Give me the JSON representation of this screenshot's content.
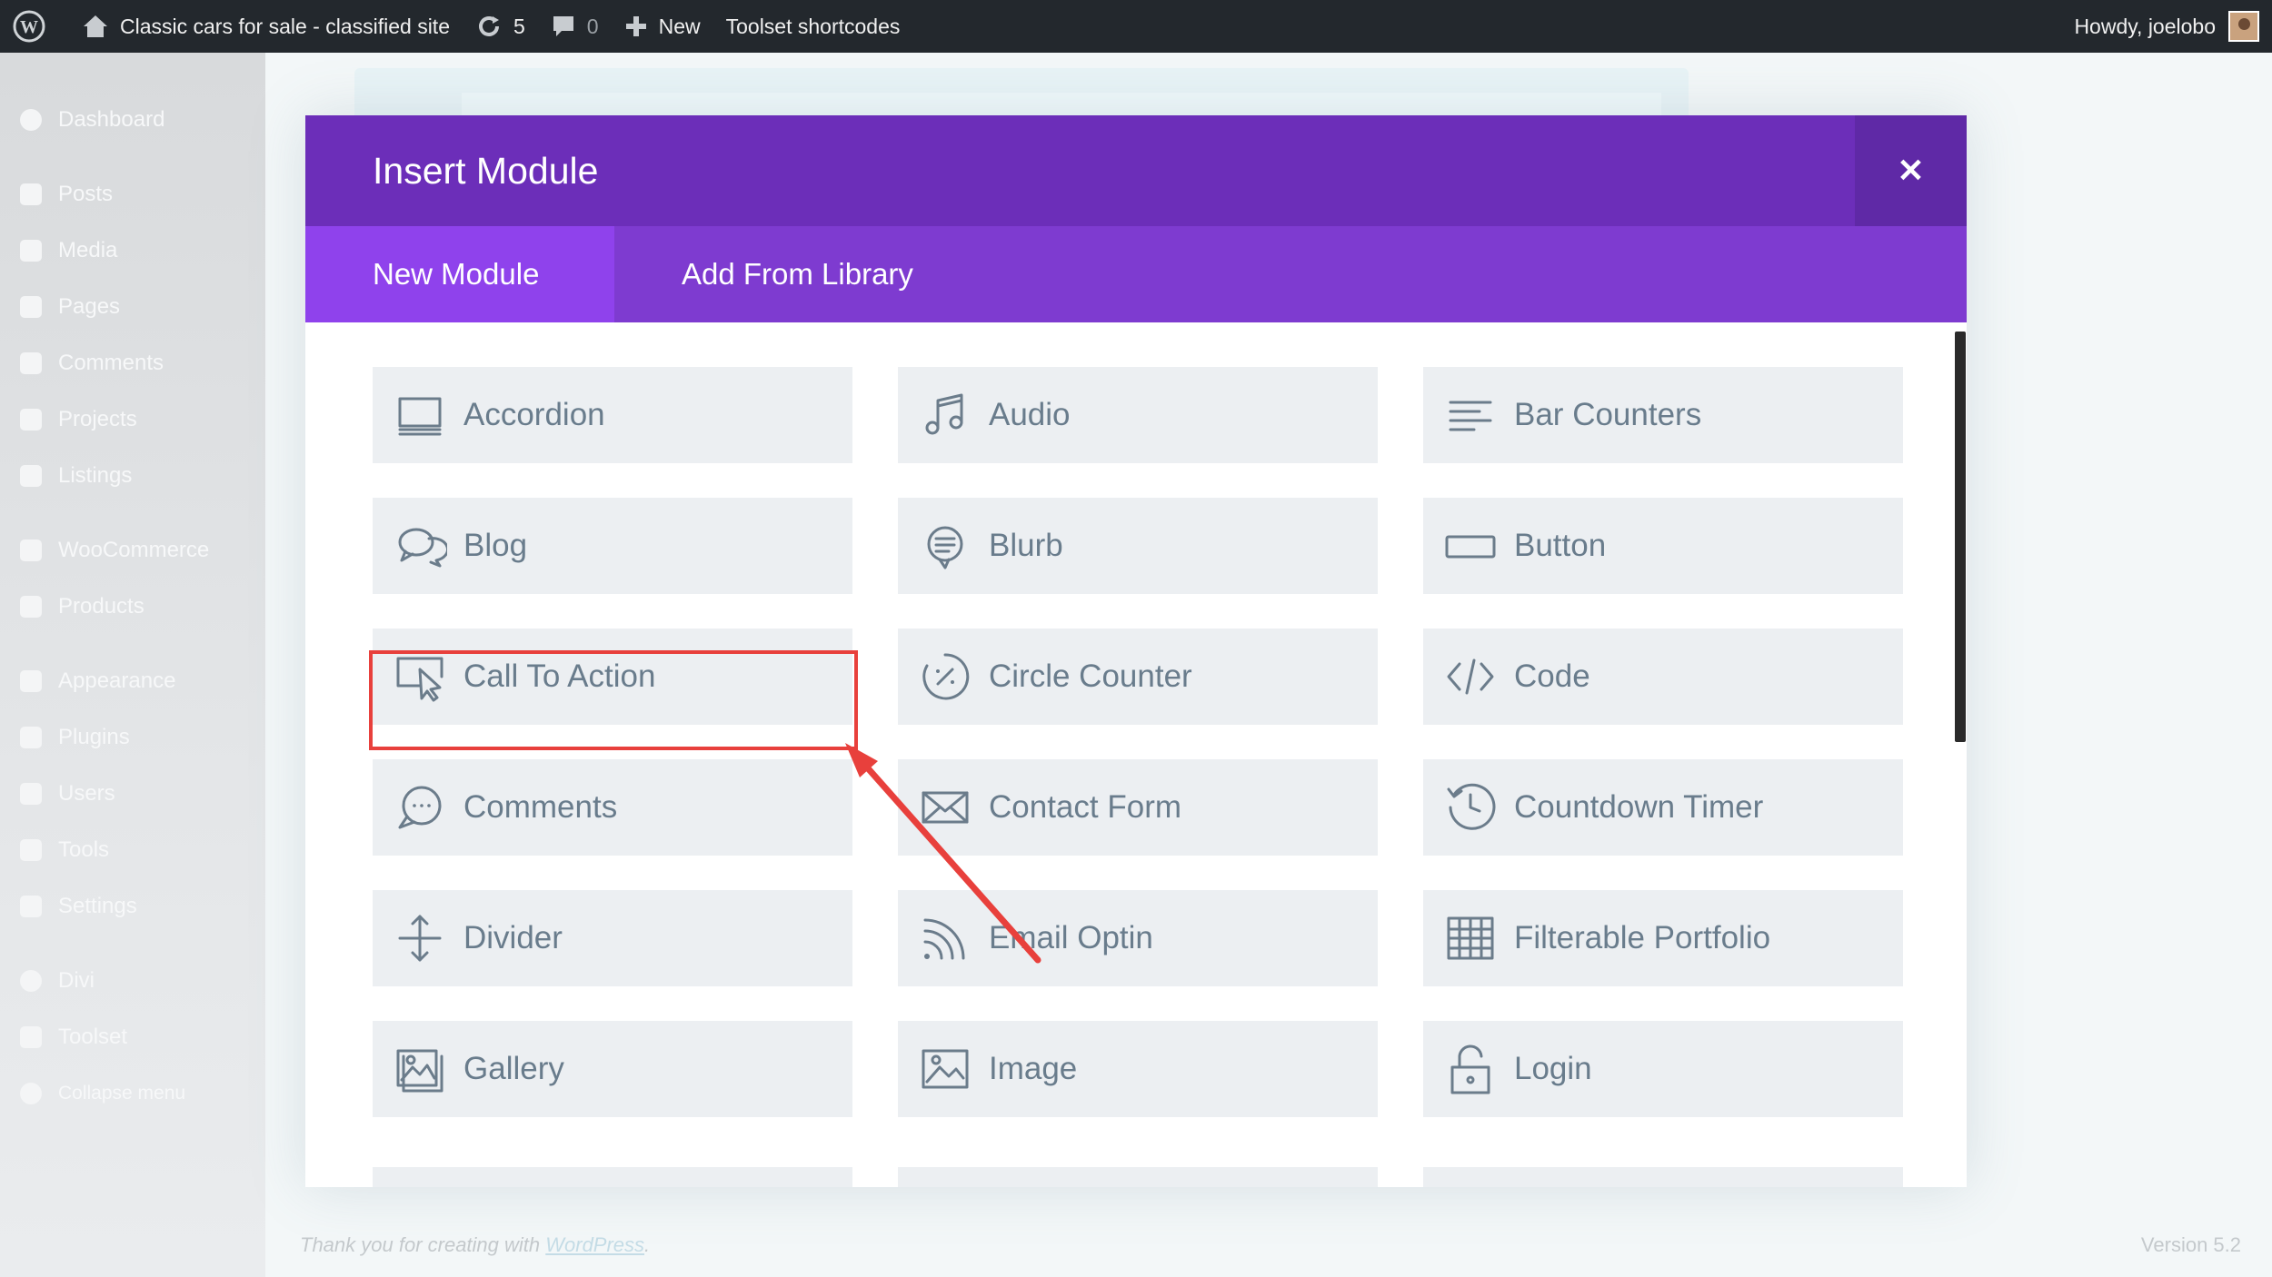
{
  "adminbar": {
    "site_name": "Classic cars for sale - classified site",
    "updates_count": "5",
    "comments_count": "0",
    "new_label": "New",
    "toolset_label": "Toolset shortcodes",
    "howdy": "Howdy, joelobo"
  },
  "sidebar": {
    "items": [
      {
        "label": "Dashboard",
        "icon": "dashboard-icon"
      },
      {
        "label": "Posts",
        "icon": "pin-icon"
      },
      {
        "label": "Media",
        "icon": "media-icon"
      },
      {
        "label": "Pages",
        "icon": "pages-icon"
      },
      {
        "label": "Comments",
        "icon": "comment-icon"
      },
      {
        "label": "Projects",
        "icon": "pin-icon"
      },
      {
        "label": "Listings",
        "icon": "pin-icon"
      },
      {
        "label": "WooCommerce",
        "icon": "woo-icon"
      },
      {
        "label": "Products",
        "icon": "box-icon"
      },
      {
        "label": "Appearance",
        "icon": "brush-icon"
      },
      {
        "label": "Plugins",
        "icon": "plug-icon"
      },
      {
        "label": "Users",
        "icon": "user-icon"
      },
      {
        "label": "Tools",
        "icon": "wrench-icon"
      },
      {
        "label": "Settings",
        "icon": "settings-icon"
      },
      {
        "label": "Divi",
        "icon": "divi-icon"
      },
      {
        "label": "Toolset",
        "icon": "toolset-icon"
      },
      {
        "label": "Collapse menu",
        "icon": "collapse-icon"
      }
    ]
  },
  "modal": {
    "title": "Insert Module",
    "close_symbol": "✕",
    "tabs": {
      "new_module": "New Module",
      "add_from_library": "Add From Library"
    },
    "modules": [
      {
        "label": "Accordion",
        "icon": "accordion-icon"
      },
      {
        "label": "Audio",
        "icon": "music-note-icon"
      },
      {
        "label": "Bar Counters",
        "icon": "bar-lines-icon"
      },
      {
        "label": "Blog",
        "icon": "speech-bubbles-icon"
      },
      {
        "label": "Blurb",
        "icon": "blurb-bubble-icon"
      },
      {
        "label": "Button",
        "icon": "button-rectangle-icon"
      },
      {
        "label": "Call To Action",
        "icon": "cursor-screen-icon"
      },
      {
        "label": "Circle Counter",
        "icon": "circle-percent-icon"
      },
      {
        "label": "Code",
        "icon": "code-brackets-icon"
      },
      {
        "label": "Comments",
        "icon": "comment-dots-icon"
      },
      {
        "label": "Contact Form",
        "icon": "envelope-icon"
      },
      {
        "label": "Countdown Timer",
        "icon": "clock-history-icon"
      },
      {
        "label": "Divider",
        "icon": "divider-arrows-icon"
      },
      {
        "label": "Email Optin",
        "icon": "rss-icon"
      },
      {
        "label": "Filterable Portfolio",
        "icon": "grid-icon"
      },
      {
        "label": "Gallery",
        "icon": "gallery-icon"
      },
      {
        "label": "Image",
        "icon": "image-icon"
      },
      {
        "label": "Login",
        "icon": "unlock-icon"
      }
    ]
  },
  "footer": {
    "thanks_prefix": "Thank you for creating with ",
    "thanks_link": "WordPress",
    "thanks_suffix": ".",
    "version": "Version 5.2"
  },
  "colors": {
    "header": "#6c2eb9",
    "tabs": "#7e3bd0",
    "active_tab": "#8f42ec",
    "highlight": "#e8403c"
  }
}
